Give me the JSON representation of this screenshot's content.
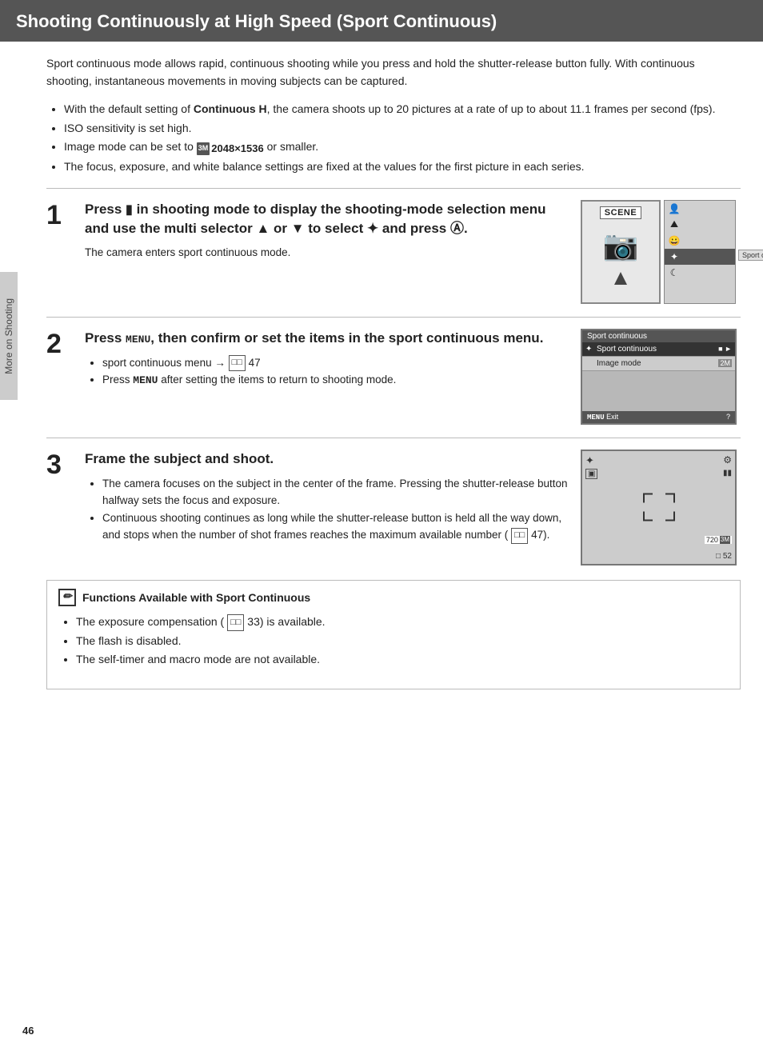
{
  "page": {
    "number": "46",
    "title": "Shooting Continuously at High Speed (Sport Continuous)",
    "side_tab": "More on Shooting"
  },
  "intro": {
    "paragraph": "Sport continuous mode allows rapid, continuous shooting while you press and hold the shutter-release button fully. With continuous shooting, instantaneous movements in moving subjects can be captured.",
    "bullets": [
      "With the default setting of Continuous H, the camera shoots up to 20 pictures at a rate of up to about 11.1 frames per second (fps).",
      "ISO sensitivity is set high.",
      "Image mode can be set to  2048×1536 or smaller.",
      "The focus, exposure, and white balance settings are fixed at the values for the first picture in each series."
    ]
  },
  "steps": [
    {
      "number": "1",
      "title": "Press  in shooting mode to display the shooting-mode selection menu and use the multi selector ▲ or ▼ to select  and press .",
      "note": "The camera enters sport continuous mode.",
      "screen": {
        "scene_label": "SCENE",
        "menu_items": [
          "portrait",
          "landscape",
          "party",
          "sport",
          "night"
        ],
        "sport_label": "Sport continuous"
      }
    },
    {
      "number": "2",
      "title": "Press MENU, then confirm or set the items in the sport continuous menu.",
      "bullets": [
        "sport continuous menu → □ 47",
        "Press MENU after setting the items to return to shooting mode."
      ],
      "screen": {
        "header": "Sport continuous",
        "rows": [
          {
            "label": "Sport continuous",
            "value": "▶",
            "highlighted": true
          },
          {
            "label": "Image mode",
            "value": ""
          }
        ],
        "footer_left": "MENU Exit",
        "footer_right": "?"
      }
    },
    {
      "number": "3",
      "title": "Frame the subject and shoot.",
      "bullets": [
        "The camera focuses on the subject in the center of the frame. Pressing the shutter-release button halfway sets the focus and exposure.",
        "Continuous shooting continues as long while the shutter-release button is held all the way down, and stops when the number of shot frames reaches the maximum available number (□ 47)."
      ]
    }
  ],
  "note": {
    "icon_text": "✎",
    "title": "Functions Available with Sport Continuous",
    "bullets": [
      "The exposure compensation (□ 33) is available.",
      "The flash is disabled.",
      "The self-timer and macro mode are not available."
    ]
  },
  "ui": {
    "continuous_h_label": "Continuous H",
    "image_mode_badge": "3M",
    "image_mode_res": "2048×1536",
    "or_connector": "or"
  }
}
